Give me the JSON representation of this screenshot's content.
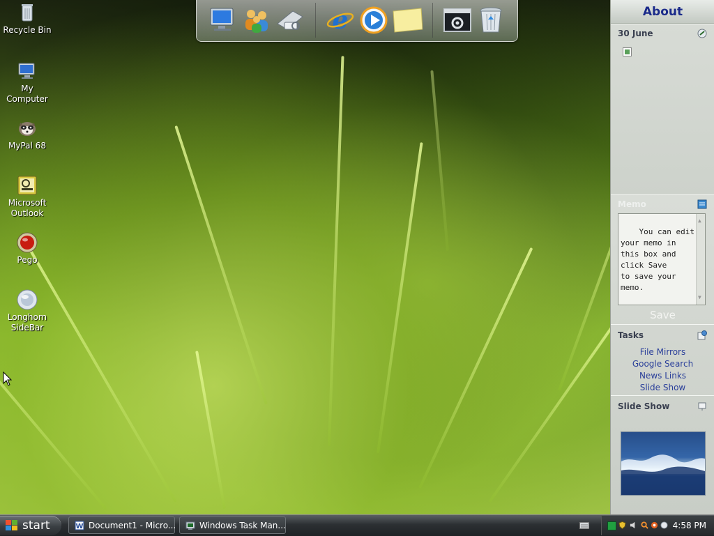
{
  "desktop": {
    "icons": [
      {
        "label": "Recycle Bin",
        "icon": "recycle-bin-icon"
      },
      {
        "label": "My Computer",
        "icon": "computer-icon"
      },
      {
        "label": "MyPal 68",
        "icon": "raccoon-icon"
      },
      {
        "label": "Microsoft Outlook",
        "icon": "outlook-icon"
      },
      {
        "label": "Pego",
        "icon": "red-orb-icon"
      },
      {
        "label": "Longhorn SideBar",
        "icon": "sidebar-orb-icon"
      }
    ]
  },
  "dock": {
    "items": [
      {
        "icon": "computer-icon"
      },
      {
        "icon": "users-icon"
      },
      {
        "icon": "network-printer-icon"
      },
      {
        "icon": "internet-explorer-icon"
      },
      {
        "icon": "media-player-icon"
      },
      {
        "icon": "sticky-note-icon"
      },
      {
        "icon": "settings-window-icon"
      },
      {
        "icon": "trash-icon"
      }
    ]
  },
  "sidebar": {
    "title": "About",
    "calendar": {
      "date": "30 June"
    },
    "memo": {
      "heading": "Memo",
      "text": "You can edit\nyour memo in\nthis box and\nclick Save\nto save your\nmemo.",
      "save_label": "Save"
    },
    "tasks": {
      "heading": "Tasks",
      "links": [
        "File Mirrors",
        "Google Search",
        "News Links",
        "Slide Show"
      ]
    },
    "slideshow": {
      "heading": "Slide Show"
    }
  },
  "taskbar": {
    "start_label": "start",
    "buttons": [
      {
        "label": "Document1 - Micro...",
        "icon": "word-icon"
      },
      {
        "label": "Windows Task Man...",
        "icon": "task-manager-icon"
      }
    ],
    "clock": "4:58 PM"
  },
  "colors": {
    "sidebar_title": "#1a2a8a",
    "link": "#2a3f9a",
    "taskbar": "#2c3033"
  }
}
